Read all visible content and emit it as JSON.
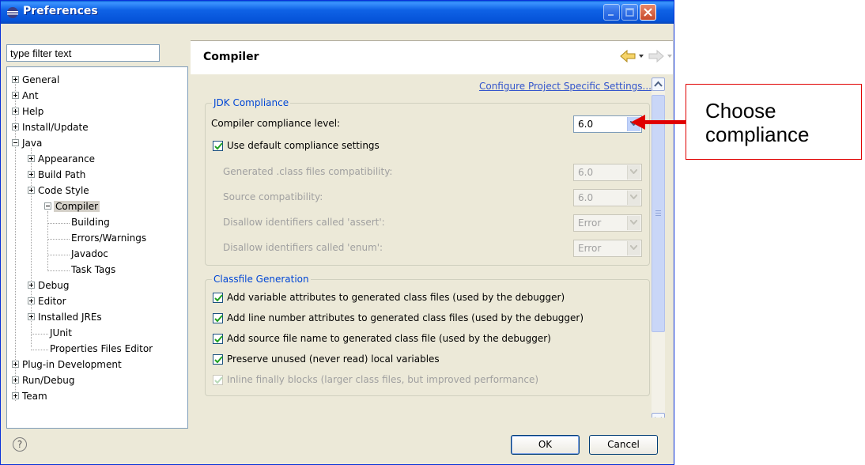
{
  "window": {
    "title": "Preferences"
  },
  "filter": {
    "placeholder": "type filter text"
  },
  "tree": {
    "general": "General",
    "ant": "Ant",
    "help": "Help",
    "install_update": "Install/Update",
    "java": "Java",
    "appearance": "Appearance",
    "build_path": "Build Path",
    "code_style": "Code Style",
    "compiler": "Compiler",
    "building": "Building",
    "errors_warnings": "Errors/Warnings",
    "javadoc": "Javadoc",
    "task_tags": "Task Tags",
    "debug": "Debug",
    "editor": "Editor",
    "installed_jres": "Installed JREs",
    "junit": "JUnit",
    "properties_files_editor": "Properties Files Editor",
    "plugin_development": "Plug-in Development",
    "run_debug": "Run/Debug",
    "team": "Team"
  },
  "page": {
    "title": "Compiler",
    "link": "Configure Project Specific Settings...",
    "jdk": {
      "title": "JDK Compliance",
      "compliance_label": "Compiler compliance level:",
      "compliance_value": "6.0",
      "use_default_label": "Use default compliance settings",
      "generated_label": "Generated .class files compatibility:",
      "generated_value": "6.0",
      "source_label": "Source compatibility:",
      "source_value": "6.0",
      "assert_label": "Disallow identifiers called 'assert':",
      "assert_value": "Error",
      "enum_label": "Disallow identifiers called 'enum':",
      "enum_value": "Error"
    },
    "classfile": {
      "title": "Classfile Generation",
      "opt1": "Add variable attributes to generated class files (used by the debugger)",
      "opt2": "Add line number attributes to generated class files (used by the debugger)",
      "opt3": "Add source file name to generated class file (used by the debugger)",
      "opt4": "Preserve unused (never read) local variables",
      "opt5": "Inline finally blocks (larger class files, but improved performance)"
    }
  },
  "buttons": {
    "ok": "OK",
    "cancel": "Cancel",
    "help": "?"
  },
  "annotation": {
    "line1": "Choose",
    "line2": "compliance"
  },
  "colors": {
    "accent": "#0046d5",
    "link": "#3355cc",
    "annotation": "#e00000"
  }
}
